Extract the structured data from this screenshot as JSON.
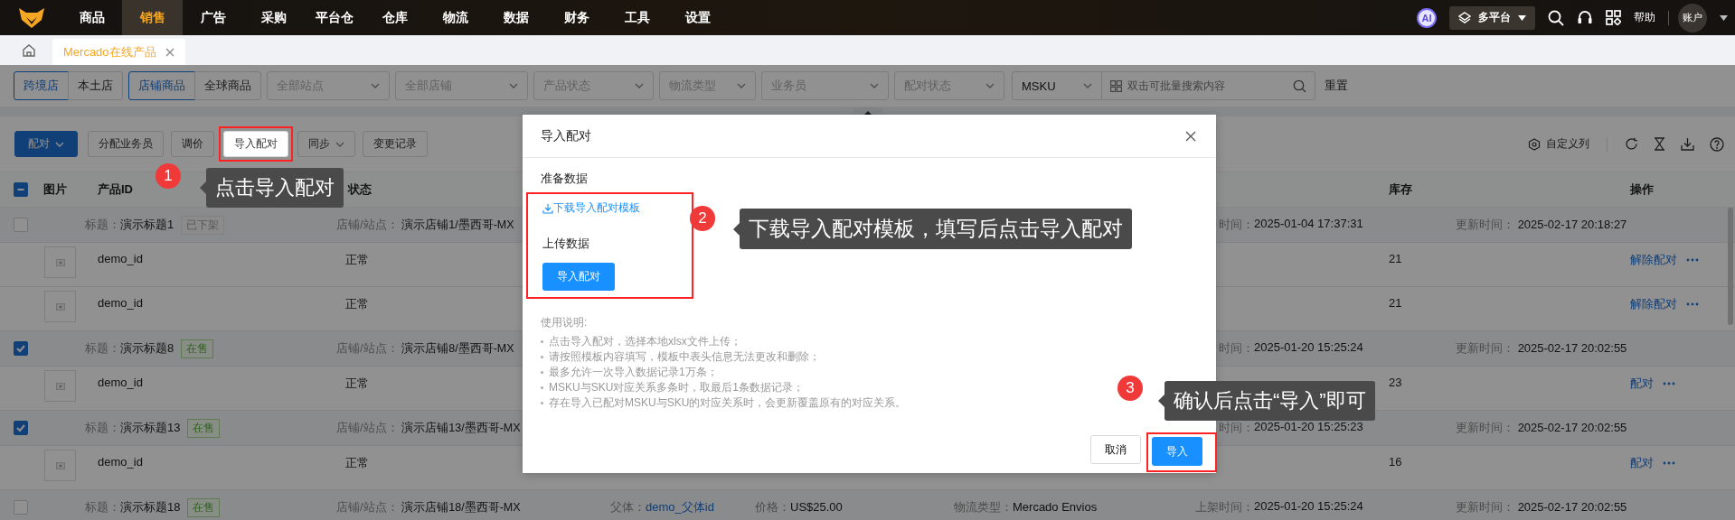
{
  "nav": {
    "items": [
      {
        "label": "商品",
        "selected": false
      },
      {
        "label": "销售",
        "selected": true
      },
      {
        "label": "广告",
        "selected": false
      },
      {
        "label": "采购",
        "selected": false
      },
      {
        "label": "平台仓",
        "selected": false
      },
      {
        "label": "仓库",
        "selected": false
      },
      {
        "label": "物流",
        "selected": false
      },
      {
        "label": "数据",
        "selected": false
      },
      {
        "label": "财务",
        "selected": false
      },
      {
        "label": "工具",
        "selected": false
      },
      {
        "label": "设置",
        "selected": false
      }
    ],
    "ai": "AI",
    "platform": "多平台",
    "help": "帮助",
    "account": "账户"
  },
  "tabs": [
    {
      "label": "Mercado在线产品",
      "selected": true
    }
  ],
  "filters": {
    "store_type": [
      {
        "label": "跨境店",
        "selected": true
      },
      {
        "label": "本土店",
        "selected": false
      }
    ],
    "scope": [
      {
        "label": "店铺商品",
        "selected": true
      },
      {
        "label": "全球商品",
        "selected": false
      }
    ],
    "selects": [
      {
        "placeholder": "全部站点"
      },
      {
        "placeholder": "全部店铺"
      },
      {
        "placeholder": "产品状态"
      },
      {
        "placeholder": "物流类型"
      },
      {
        "placeholder": "业务员"
      },
      {
        "placeholder": "配对状态"
      }
    ],
    "search_type": "MSKU",
    "search": {
      "placeholder": "双击可批量搜索内容"
    },
    "reset": "重置"
  },
  "toolbar": {
    "buttons": [
      {
        "label": "配对",
        "kind": "primary-dropdown"
      },
      {
        "label": "分配业务员",
        "kind": "plain"
      },
      {
        "label": "调价",
        "kind": "plain"
      },
      {
        "label": "导入配对",
        "kind": "highlighted"
      },
      {
        "label": "同步",
        "kind": "dropdown"
      },
      {
        "label": "变更记录",
        "kind": "plain"
      }
    ],
    "custom_columns": "自定义列"
  },
  "table": {
    "select_all": {
      "checked": true,
      "partial": true
    },
    "columns": [
      "图片",
      "产品ID",
      "状态",
      "库存",
      "操作"
    ],
    "groups": [
      {
        "checked": false,
        "title_label": "标题：",
        "title": "演示标题1",
        "status": {
          "label": "已下架",
          "kind": "off"
        },
        "store_label": "店铺/站点：",
        "store": "演示店铺1/墨西哥-MX",
        "launch_label": "时间：",
        "launch": "2025-01-04 17:37:31",
        "update_label": "更新时间：",
        "update": "2025-02-17 20:18:27",
        "items": [
          {
            "id": "demo_id",
            "state": "正常",
            "stock": "21",
            "action": "解除配对"
          },
          {
            "id": "demo_id",
            "state": "正常",
            "stock": "21",
            "action": "解除配对"
          }
        ]
      },
      {
        "checked": true,
        "title_label": "标题：",
        "title": "演示标题8",
        "status": {
          "label": "在售",
          "kind": "on"
        },
        "store_label": "店铺/站点：",
        "store": "演示店铺8/墨西哥-MX",
        "launch_label": "时间：",
        "launch": "2025-01-20 15:25:24",
        "update_label": "更新时间：",
        "update": "2025-02-17 20:02:55",
        "items": [
          {
            "id": "demo_id",
            "state": "正常",
            "stock": "23",
            "action": "配对"
          }
        ]
      },
      {
        "checked": true,
        "title_label": "标题：",
        "title": "演示标题13",
        "status": {
          "label": "在售",
          "kind": "on"
        },
        "store_label": "店铺/站点：",
        "store": "演示店铺13/墨西哥-MX",
        "launch_label": "时间：",
        "launch": "2025-01-20 15:25:23",
        "update_label": "更新时间：",
        "update": "2025-02-17 20:02:55",
        "items": [
          {
            "id": "demo_id",
            "state": "正常",
            "stock": "16",
            "action": "配对"
          }
        ]
      },
      {
        "checked": false,
        "title_label": "标题：",
        "title": "演示标题18",
        "status": {
          "label": "在售",
          "kind": "on"
        },
        "store_label": "店铺/站点：",
        "store": "演示店铺18/墨西哥-MX",
        "parent_label": "父体：",
        "parent": "demo_父体id",
        "price_label": "价格：",
        "price": "US$25.00",
        "logistics_label": "物流类型：",
        "logistics": "Mercado Envios",
        "launch_label": "上架时间：",
        "launch": "2025-01-20 15:25:24",
        "update_label": "更新时间：",
        "update": "2025-02-17 20:02:55"
      }
    ]
  },
  "dialog": {
    "title": "导入配对",
    "prepare": "准备数据",
    "download": "下载导入配对模板",
    "upload": "上传数据",
    "upload_button": "导入配对",
    "notes_title": "使用说明:",
    "notes": [
      "点击导入配对，选择本地xlsx文件上传；",
      "请按照模板内容填写，模板中表头信息无法更改和删除；",
      "最多允许一次导入数据记录1万条；",
      "MSKU与SKU对应关系多条时，取最后1条数据记录；",
      "存在导入已配对MSKU与SKU的对应关系时，会更新覆盖原有的对应关系。"
    ],
    "cancel": "取消",
    "confirm": "导入"
  },
  "callouts": [
    {
      "number": "1",
      "text": "点击导入配对"
    },
    {
      "number": "2",
      "text": "下载导入配对模板，填写后点击导入配对"
    },
    {
      "number": "3",
      "text": "确认后点击“导入”即可"
    }
  ]
}
